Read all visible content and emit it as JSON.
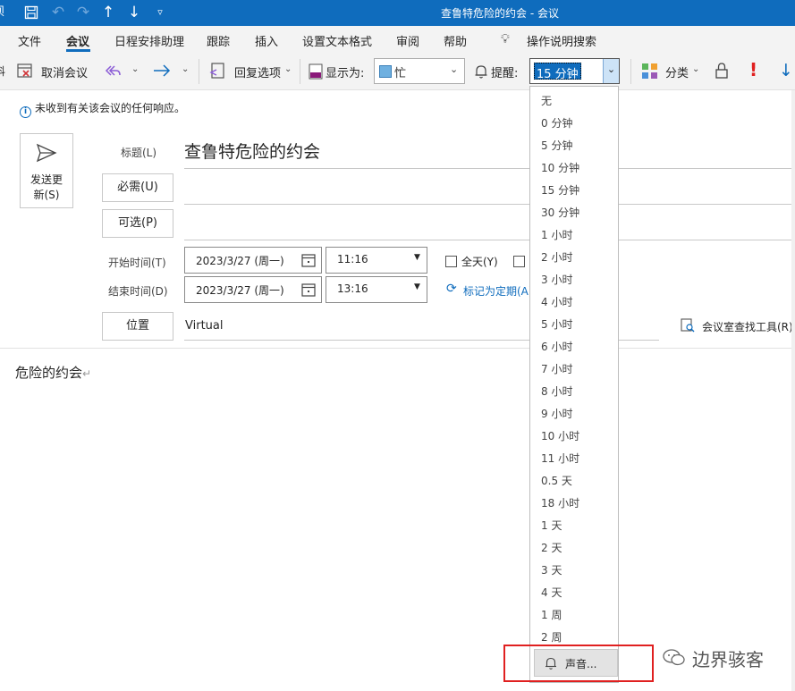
{
  "window": {
    "title": "查鲁特危险的约会 - 会议",
    "left_char": "坝"
  },
  "titlebar_icons": [
    "save-icon",
    "undo-icon",
    "redo-icon",
    "arrow-up-icon",
    "arrow-down-icon",
    "customize-icon"
  ],
  "menu": {
    "items": [
      "文件",
      "会议",
      "日程安排助理",
      "跟踪",
      "插入",
      "设置文本格式",
      "审阅",
      "帮助"
    ],
    "active_index": 1,
    "search_label": "操作说明搜索"
  },
  "ribbon": {
    "cancel_meeting": "取消会议",
    "reply_options": "回复选项",
    "show_as_label": "显示为:",
    "show_as_value": "忙",
    "reminder_label": "提醒:",
    "reminder_value": "15 分钟",
    "categorize": "分类",
    "left_edge_char": "料"
  },
  "info_bar": {
    "text": "未收到有关该会议的任何响应。"
  },
  "form": {
    "send_update_label": "发送更新(S)",
    "send_update_line1": "发送更",
    "send_update_line2": "新(S)",
    "title_label": "标题(L)",
    "title_value": "查鲁特危险的约会",
    "required_button": "必需(U)",
    "optional_button": "可选(P)",
    "start_label": "开始时间(T)",
    "start_date": "2023/3/27 (周一)",
    "start_time": "11:16",
    "end_label": "结束时间(D)",
    "end_date": "2023/3/27 (周一)",
    "end_time": "13:16",
    "all_day_label": "全天(Y)",
    "recurring_label": "标记为定期(A)",
    "location_button": "位置",
    "location_value": "Virtual",
    "room_finder": "会议室查找工具(R)"
  },
  "body": {
    "text": "危险的约会",
    "paragraph_mark": "↵"
  },
  "reminder_dropdown": {
    "options": [
      "无",
      "0 分钟",
      "5 分钟",
      "10 分钟",
      "15 分钟",
      "30 分钟",
      "1 小时",
      "2 小时",
      "3 小时",
      "4 小时",
      "5 小时",
      "6 小时",
      "7 小时",
      "8 小时",
      "9 小时",
      "10 小时",
      "11 小时",
      "0.5 天",
      "18 小时",
      "1 天",
      "2 天",
      "3 天",
      "4 天",
      "1 周",
      "2 周"
    ],
    "sound_button": "声音..."
  },
  "watermark": {
    "text": "边界骇客"
  },
  "colors": {
    "accent": "#0f6cbd",
    "busy": "#6fb0e0",
    "importance_high": "#e02020",
    "highlight_box": "#e02020"
  }
}
